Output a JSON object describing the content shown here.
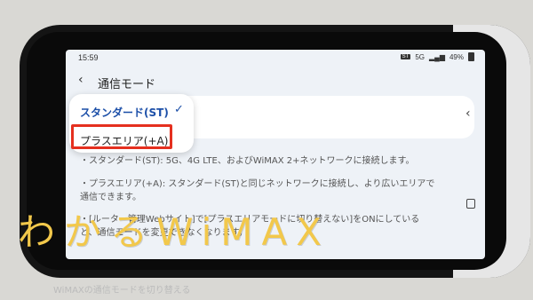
{
  "status_bar": {
    "time": "15:59",
    "badge": "ST",
    "signal_small": "5G",
    "battery": "49%"
  },
  "header": {
    "title": "通信モード"
  },
  "popup": {
    "options": [
      {
        "label": "スタンダード(ST)",
        "selected": true
      },
      {
        "label": "プラスエリア(+A)",
        "selected": false
      }
    ]
  },
  "descriptions": [
    "・スタンダード(ST): 5G、4G LTE、およびWiMAX 2+ネットワークに接続します。",
    "・プラスエリア(+A): スタンダード(ST)と同じネットワークに接続し、より広いエリアで通信できます。",
    "・[ルーター管理Webサイト]で[プラスエリアモードに切り替えない]をONにしていると、通信モードを変更できなくなります。"
  ],
  "watermark": "わかるWiMAX",
  "below_text": "WiMAXの通信モードを切り替える",
  "colors": {
    "accent": "#1c4fa8",
    "highlight": "#e5301f",
    "watermark": "#f2c84b"
  }
}
